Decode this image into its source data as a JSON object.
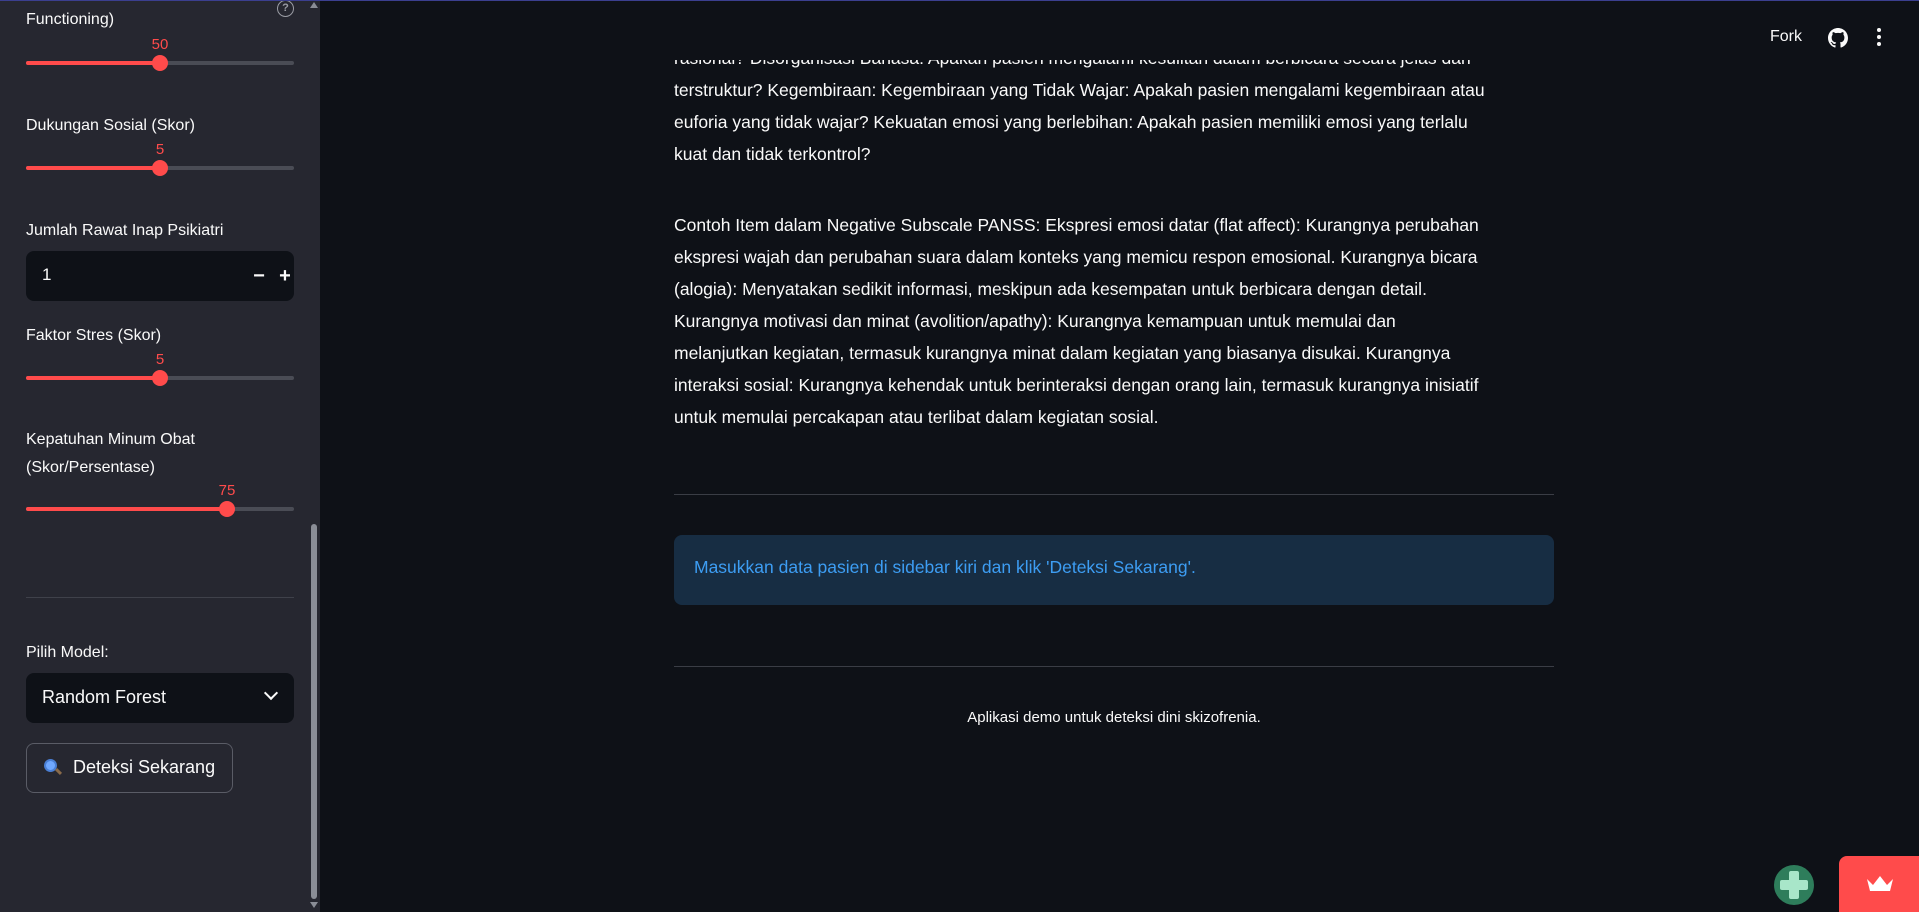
{
  "sidebar": {
    "top_label_partial": "Functioning)",
    "sliders": [
      {
        "id": "gaf",
        "value": "50",
        "fraction": 0.5
      },
      {
        "id": "dukungan",
        "label": "Dukungan Sosial (Skor)",
        "value": "5",
        "fraction": 0.5
      },
      {
        "id": "stres",
        "label": "Faktor Stres (Skor)",
        "value": "5",
        "fraction": 0.5
      },
      {
        "id": "kepatuhan",
        "label_line1": "Kepatuhan Minum Obat",
        "label_line2": "(Skor/Persentase)",
        "value": "75",
        "fraction": 0.75
      }
    ],
    "rawat_inap": {
      "label": "Jumlah Rawat Inap Psikiatri",
      "value": "1",
      "minus": "−",
      "plus": "+"
    },
    "model": {
      "label": "Pilih Model:",
      "selected": "Random Forest"
    },
    "detect_button": "Deteksi Sekarang",
    "help_icon": "?"
  },
  "main": {
    "para1_lines": [
      "rasional? Disorganisasi Bahasa: Apakah pasien mengalami kesulitan dalam berbicara secara jelas dan",
      "terstruktur? Kegembiraan: Kegembiraan yang Tidak Wajar: Apakah pasien mengalami kegembiraan atau",
      "euforia yang tidak wajar? Kekuatan emosi yang berlebihan: Apakah pasien memiliki emosi yang terlalu",
      "kuat dan tidak terkontrol?"
    ],
    "para2_lines": [
      "Contoh Item dalam Negative Subscale PANSS: Ekspresi emosi datar (flat affect): Kurangnya perubahan",
      "ekspresi wajah dan perubahan suara dalam konteks yang memicu respon emosional. Kurangnya bicara",
      "(alogia): Menyatakan sedikit informasi, meskipun ada kesempatan untuk berbicara dengan detail.",
      "Kurangnya motivasi dan minat (avolition/apathy): Kurangnya kemampuan untuk memulai dan",
      "melanjutkan kegiatan, termasuk kurangnya minat dalam kegiatan yang biasanya disukai. Kurangnya",
      "interaksi sosial: Kurangnya kehendak untuk berinteraksi dengan orang lain, termasuk kurangnya inisiatif",
      "untuk memulai percakapan atau terlibat dalam kegiatan sosial."
    ],
    "info": "Masukkan data pasien di sidebar kiri dan klik 'Deteksi Sekarang'.",
    "footer": "Aplikasi demo untuk deteksi dini skizofrenia."
  },
  "header": {
    "fork": "Fork",
    "icons": [
      "github-icon",
      "kebab-menu-icon"
    ]
  },
  "colors": {
    "accent": "#ff4b4b",
    "info_text": "#3d9df3",
    "info_bg": "#172d43",
    "bg": "#0e1117",
    "sidebar_bg": "#262730"
  }
}
